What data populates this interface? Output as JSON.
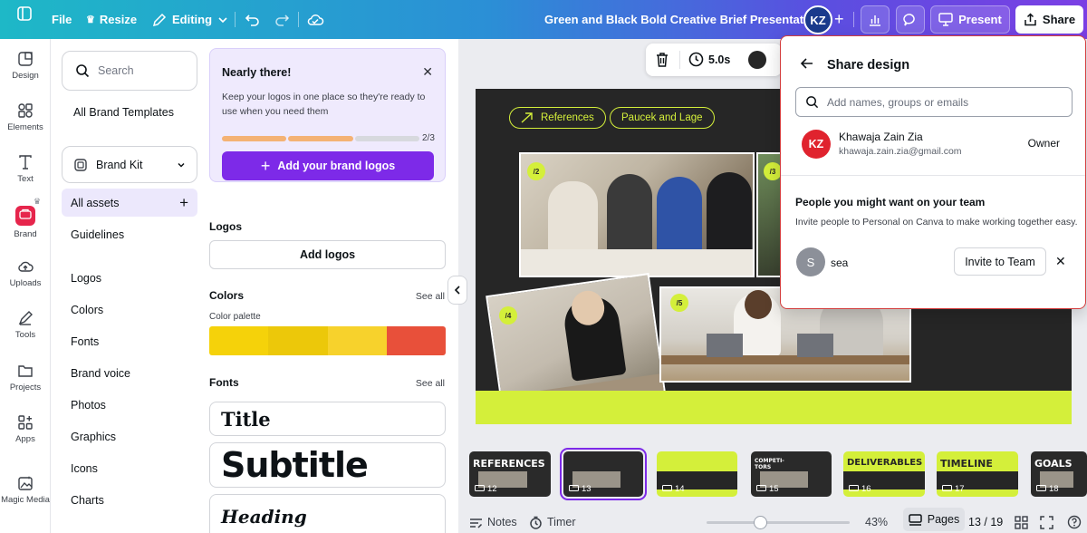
{
  "topbar": {
    "file_label": "File",
    "resize_label": "Resize",
    "editing_label": "Editing",
    "doc_title": "Green and Black Bold Creative Brief Presentation",
    "avatar_initials": "KZ",
    "present_label": "Present",
    "share_label": "Share"
  },
  "rail": {
    "items": [
      {
        "label": "Design",
        "icon": "design-icon"
      },
      {
        "label": "Elements",
        "icon": "elements-icon"
      },
      {
        "label": "Text",
        "icon": "text-icon"
      },
      {
        "label": "Brand",
        "icon": "brand-icon"
      },
      {
        "label": "Uploads",
        "icon": "uploads-icon"
      },
      {
        "label": "Tools",
        "icon": "tools-icon"
      },
      {
        "label": "Projects",
        "icon": "projects-icon"
      },
      {
        "label": "Apps",
        "icon": "apps-icon"
      },
      {
        "label": "Magic Media",
        "icon": "magic-media-icon"
      }
    ]
  },
  "panel": {
    "search_placeholder": "Search",
    "all_brand_templates": "All Brand Templates",
    "brand_kit_label": "Brand Kit",
    "all_assets": "All assets",
    "guidelines": "Guidelines",
    "nav": [
      "Logos",
      "Colors",
      "Fonts",
      "Brand voice",
      "Photos",
      "Graphics",
      "Icons",
      "Charts"
    ],
    "promo": {
      "title": "Nearly there!",
      "desc": "Keep your logos in one place so they're ready to use when you need them",
      "progress_text": "2/3",
      "progress_done": 2,
      "progress_total": 3,
      "button": "Add your brand logos"
    },
    "logos": {
      "heading": "Logos",
      "button": "Add logos"
    },
    "colors": {
      "heading": "Colors",
      "see_all": "See all",
      "palette_label": "Color palette",
      "palette": [
        "#f5d20a",
        "#ecc80a",
        "#f7d22c",
        "#e8503a"
      ]
    },
    "fonts": {
      "heading": "Fonts",
      "see_all": "See all",
      "title_sample": "Title",
      "subtitle_sample": "Subtitle",
      "heading_sample": "Heading"
    }
  },
  "canvas": {
    "duration": "5.0s",
    "pill_references": "References",
    "pill_paucek": "Paucek and Lage",
    "tags": [
      "/2",
      "/3",
      "/4",
      "/5"
    ]
  },
  "share": {
    "title": "Share design",
    "input_placeholder": "Add names, groups or emails",
    "owner_initials": "KZ",
    "owner_name": "Khawaja Zain Zia",
    "owner_email": "khawaja.zain.zia@gmail.com",
    "owner_role": "Owner",
    "team_heading": "People you might want on your team",
    "team_sub": "Invite people to Personal on Canva to make working together easy.",
    "suggest_initial": "S",
    "suggest_name": "sea",
    "invite_button": "Invite to Team"
  },
  "filmstrip": [
    {
      "num": "12",
      "title": "REFERENCES",
      "bg": "#2a2a2a"
    },
    {
      "num": "13",
      "title": "",
      "bg": "#2a2a2a",
      "active": true
    },
    {
      "num": "14",
      "title": "",
      "bg": "#d4ef3a"
    },
    {
      "num": "15",
      "title": "COMPETI-TORS",
      "bg": "#2a2a2a"
    },
    {
      "num": "16",
      "title": "DELIVERABLES",
      "bg": "#d4ef3a"
    },
    {
      "num": "17",
      "title": "TIMELINE",
      "bg": "#d4ef3a"
    },
    {
      "num": "18",
      "title": "GOALS",
      "bg": "#2a2a2a"
    }
  ],
  "bottombar": {
    "notes": "Notes",
    "timer": "Timer",
    "zoom": "43%",
    "pages": "Pages",
    "page_count": "13 / 19"
  }
}
